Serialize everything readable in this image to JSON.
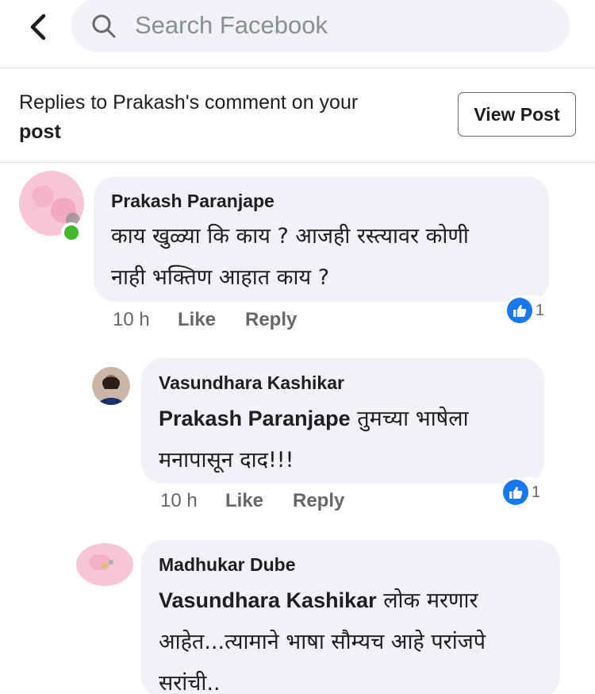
{
  "search": {
    "placeholder": "Search Facebook"
  },
  "header": {
    "title": "Replies to Prakash's comment on your",
    "title_bold": "post",
    "view_post_label": "View Post"
  },
  "comments": [
    {
      "author": "Prakash Paranjape",
      "lines": [
        "काय खुळ्या कि काय ? आजही रस्त्यावर कोणी",
        "नाही भक्तिण आहात काय ?"
      ],
      "time": "10 h",
      "like_label": "Like",
      "reply_label": "Reply",
      "reactions": "1",
      "online": true
    },
    {
      "author": "Vasundhara Kashikar",
      "mention": "Prakash Paranjape",
      "lines": [
        "तुमच्या भाषेला",
        "मनापासून दाद!!!"
      ],
      "time": "10 h",
      "like_label": "Like",
      "reply_label": "Reply",
      "reactions": "1"
    },
    {
      "author": "Madhukar Dube",
      "mention": "Vasundhara Kashikar",
      "lines": [
        "लोक मरणार",
        "आहेत...त्यामाने  भाषा सौम्यच आहे परांजपे",
        "सरांची.."
      ]
    }
  ],
  "colors": {
    "accent": "#1877f2",
    "online": "#42b72a",
    "bubble": "#f0f2f5",
    "meta": "#65676b"
  }
}
